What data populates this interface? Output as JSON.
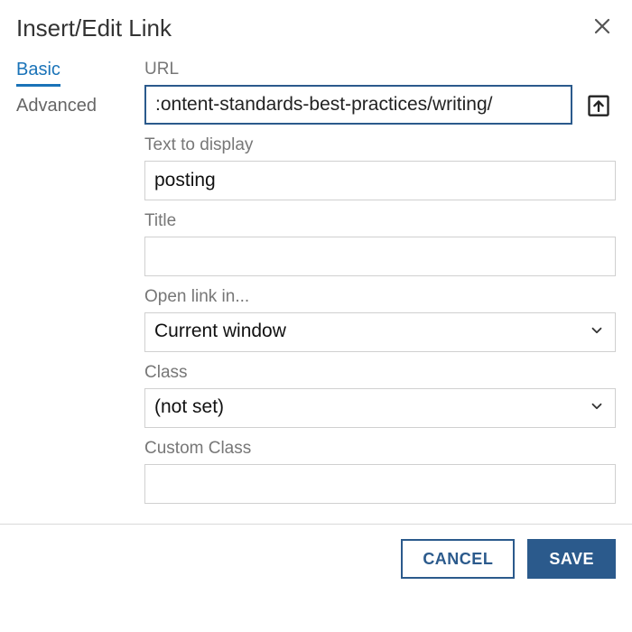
{
  "dialog": {
    "title": "Insert/Edit Link"
  },
  "tabs": {
    "basic": "Basic",
    "advanced": "Advanced"
  },
  "fields": {
    "url": {
      "label": "URL",
      "value": ":ontent-standards-best-practices/writing/"
    },
    "text_to_display": {
      "label": "Text to display",
      "value": "posting"
    },
    "title": {
      "label": "Title",
      "value": ""
    },
    "open_link": {
      "label": "Open link in...",
      "value": "Current window"
    },
    "class": {
      "label": "Class",
      "value": "(not set)"
    },
    "custom_class": {
      "label": "Custom Class",
      "value": ""
    }
  },
  "buttons": {
    "cancel": "CANCEL",
    "save": "SAVE"
  }
}
